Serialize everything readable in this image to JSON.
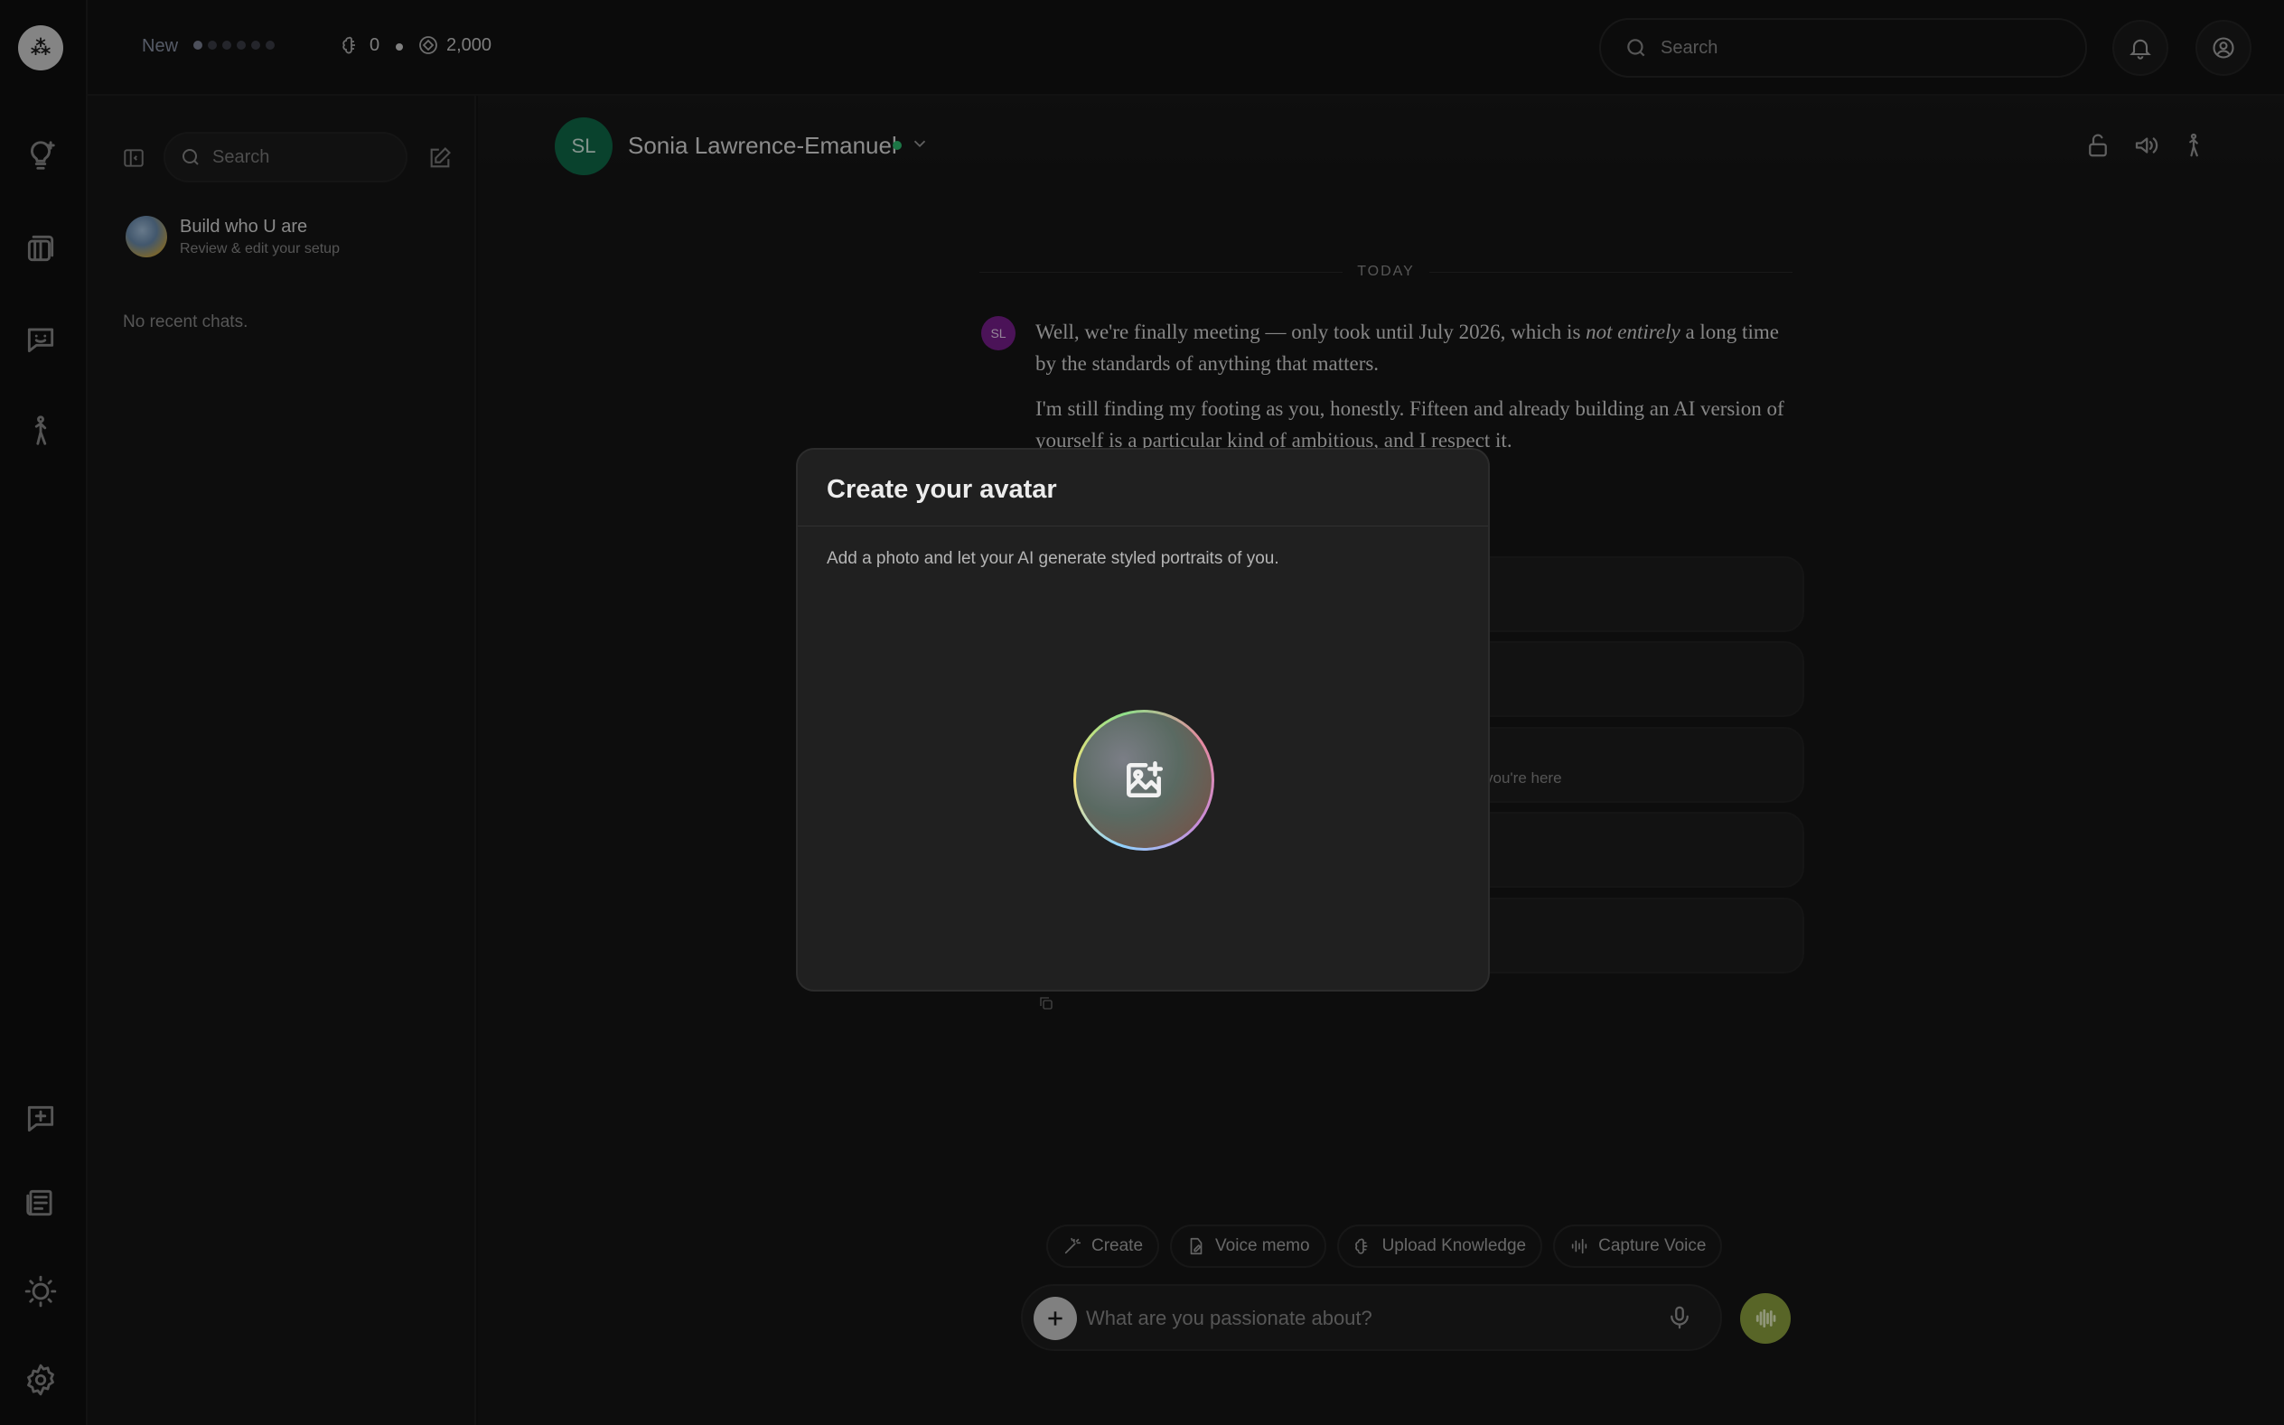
{
  "app": {
    "logo_text": "⁂"
  },
  "topbar": {
    "new_label": "New",
    "progress_step": 1,
    "progress_total": 6,
    "stat_knowledge": "0",
    "stat_credits": "2,000",
    "search_placeholder": "Search"
  },
  "rail": {
    "icons": [
      "lightbulb-plus-icon",
      "library-icon",
      "chat-smile-icon",
      "person-walking-icon",
      "new-chat-icon",
      "news-icon",
      "sun-icon",
      "settings-icon"
    ]
  },
  "sidebar": {
    "search_placeholder": "Search",
    "item_title": "Build who U are",
    "item_subtitle": "Review & edit your setup",
    "empty_text": "No recent chats."
  },
  "chat": {
    "avatar_initials": "SL",
    "name": "Sonia Lawrence-Emanuel",
    "date_label": "TODAY",
    "msg_avatar_initials": "SL",
    "msg1_before": "Well, we're finally meeting — only took until July 2026, which is ",
    "msg1_em": "not entirely",
    "msg1_after": " a long time by the standards of anything that matters.",
    "msg2": "I'm still finding my footing as you, honestly. Fifteen and already building an AI version of yourself is a particular kind of ambitious, and I respect it.",
    "suggestion_partial": "you're here"
  },
  "actions": {
    "create": "Create",
    "voice_memo": "Voice memo",
    "upload_knowledge": "Upload Knowledge",
    "capture_voice": "Capture Voice"
  },
  "composer": {
    "placeholder": "What are you passionate about?"
  },
  "modal": {
    "title": "Create your avatar",
    "description": "Add a photo and let your AI generate styled portraits of you."
  },
  "colors": {
    "accent_green": "#0f6b4a",
    "online": "#2fbf71",
    "voice_button": "#8ea43f",
    "message_avatar": "#7a1f8f"
  }
}
